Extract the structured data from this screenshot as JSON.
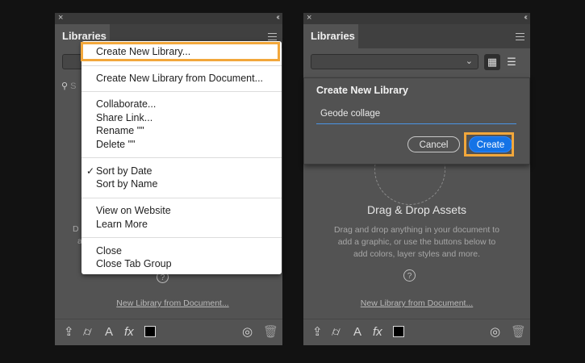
{
  "left_panel": {
    "tab": "Libraries",
    "new_library_link": "New Library from Document...",
    "partial_text_1": "D",
    "partial_text_2": "a",
    "search_partial": "S"
  },
  "flyout_menu": {
    "items": [
      "Create New Library...",
      "Create New Library from Document...",
      "Collaborate...",
      "Share Link...",
      "Rename \"\"",
      "Delete \"\"",
      "Sort by Date",
      "Sort by Name",
      "View on Website",
      "Learn More",
      "Close",
      "Close Tab Group"
    ],
    "checked_item": "Sort by Date",
    "highlight_color": "#f2a73b"
  },
  "right_panel": {
    "tab": "Libraries",
    "drop_title": "Drag & Drop Assets",
    "drop_desc_lines": [
      "Drag and drop anything in your document to",
      "add a graphic, or use the buttons below to",
      "add colors, layer styles and more."
    ],
    "new_library_link": "New Library from Document..."
  },
  "dialog": {
    "title": "Create New Library",
    "input_value": "Geode collage",
    "cancel_label": "Cancel",
    "create_label": "Create",
    "accent": "#1473e6"
  },
  "icons": {
    "close": "×",
    "collapse": "‹‹",
    "chevron": "⌄",
    "help": "?",
    "bottom": [
      "upload-icon",
      "brush-icon",
      "text-icon",
      "fx-icon",
      "color-swatch",
      "cc-sync-icon",
      "trash-icon"
    ]
  }
}
